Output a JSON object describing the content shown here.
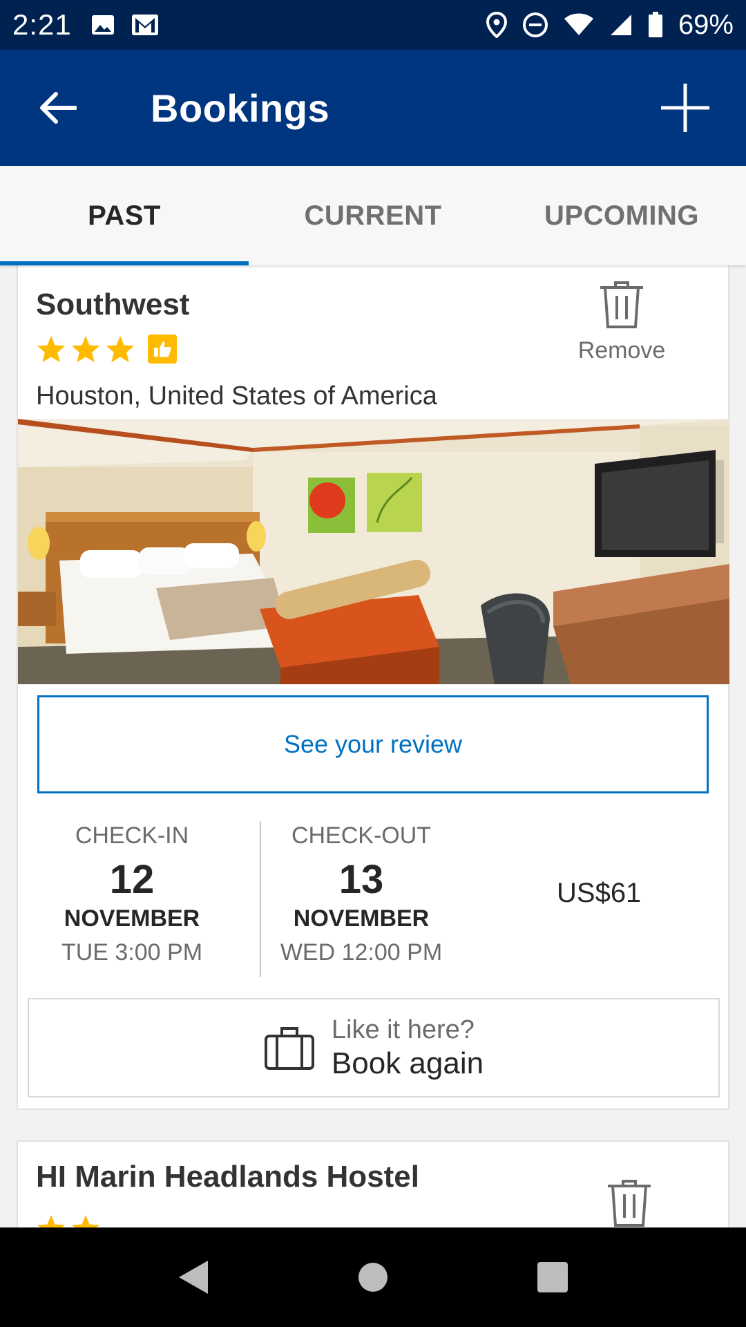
{
  "status_bar": {
    "time": "2:21",
    "battery": "69%",
    "icons": [
      "image-icon",
      "gmail-icon",
      "location-icon",
      "dnd-icon",
      "wifi-icon",
      "signal-icon",
      "battery-icon"
    ]
  },
  "app_bar": {
    "title": "Bookings",
    "back_icon": "arrow-left-icon",
    "add_icon": "plus-icon",
    "background": "#003580"
  },
  "tabs": [
    {
      "label": "PAST",
      "active": true
    },
    {
      "label": "CURRENT",
      "active": false
    },
    {
      "label": "UPCOMING",
      "active": false
    }
  ],
  "bookings": [
    {
      "name_partial_line": "",
      "name": "Southwest",
      "stars": 3,
      "thumbs_up_badge": true,
      "location": "Houston, United States of America",
      "remove_label": "Remove",
      "review_button": "See your review",
      "check_in": {
        "label": "CHECK-IN",
        "day": "12",
        "month": "NOVEMBER",
        "time": "TUE 3:00 PM"
      },
      "check_out": {
        "label": "CHECK-OUT",
        "day": "13",
        "month": "NOVEMBER",
        "time": "WED 12:00 PM"
      },
      "price": "US$61",
      "book_again": {
        "question": "Like it here?",
        "action": "Book again"
      }
    },
    {
      "name": "HI Marin Headlands Hostel",
      "stars": 2
    }
  ],
  "colors": {
    "primary_dark": "#002251",
    "primary": "#003580",
    "accent_blue": "#0071c2",
    "star_yellow": "#febb02"
  }
}
